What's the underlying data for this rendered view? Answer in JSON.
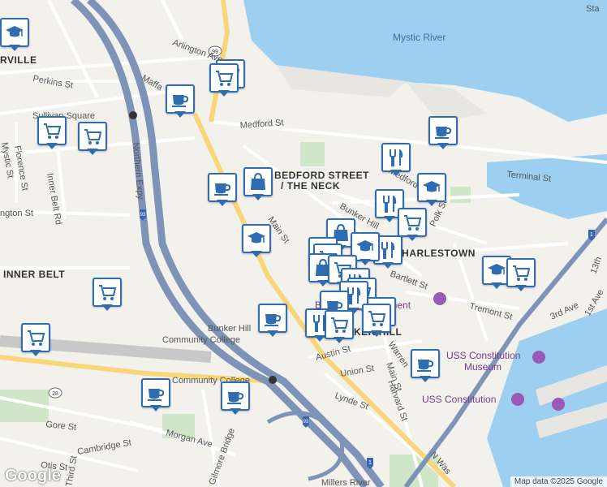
{
  "map": {
    "attribution": "Map data ©2025 Google",
    "logo": "Google",
    "labels": {
      "water_mystic": "Mystic River",
      "neighborhood_bedford": "BEDFORD STREET",
      "neighborhood_neck": "/ THE NECK",
      "neighborhood_charlestown": "CHARLESTOWN",
      "neighborhood_inner_belt": "INNER BELT",
      "neighborhood_somerville": "RVILLE",
      "neighborhood_hill": "KER HILL",
      "street_arlington": "Arlington Ave",
      "street_perkins": "Perkins St",
      "street_maffa": "Maffa",
      "street_medford": "Medford St",
      "street_medford2": "Medford",
      "street_terminal": "Terminal St",
      "street_bunker_hill": "Bunker Hill",
      "street_main": "Main St",
      "street_main2": "Main St",
      "street_polk": "Polk St",
      "street_bartlett": "Bartlett St",
      "street_tremont": "Tremont St",
      "street_austin": "Austin St",
      "street_union": "Union St",
      "street_warren": "Warren",
      "street_harvard": "Harvard St",
      "street_lynde": "Lynde St",
      "street_gore": "Gore St",
      "street_cambridge": "Cambridge St",
      "street_morgan": "Morgan Ave",
      "street_otis": "Otis St",
      "street_gilmore": "Gilmore Bridge",
      "street_thorndike": "Thorndike St",
      "street_n_wash": "N Was",
      "street_third": "Third St",
      "street_northern": "Northern Expy",
      "street_inner_belt": "Inner Belt Rd",
      "street_mystic": "Mystic St",
      "street_florence": "Florence St",
      "street_washington": "ngton St",
      "street_3rd_ave": "3rd Ave",
      "street_1st_ave": "1st Ave",
      "street_13th": "13th",
      "street_millers": "Millers River",
      "station_sullivan": "Sullivan Square",
      "station_community": "Community College",
      "poi_bhcc_1": "Bunker Hill",
      "poi_bhcc_2": "Community College",
      "poi_monument": "Bunker Hill Monument",
      "poi_uss_museum_1": "USS Constitution",
      "poi_uss_museum_2": "Museum",
      "poi_uss": "USS Constitution",
      "poi_sta": "Sta",
      "shield_93": "93",
      "shield_99": "99",
      "shield_28": "28",
      "shield_1": "1"
    },
    "marker_icons": [
      "education-icon",
      "grocery-cart-icon",
      "coffee-cup-icon",
      "shopping-bag-icon",
      "restaurant-icon"
    ]
  }
}
